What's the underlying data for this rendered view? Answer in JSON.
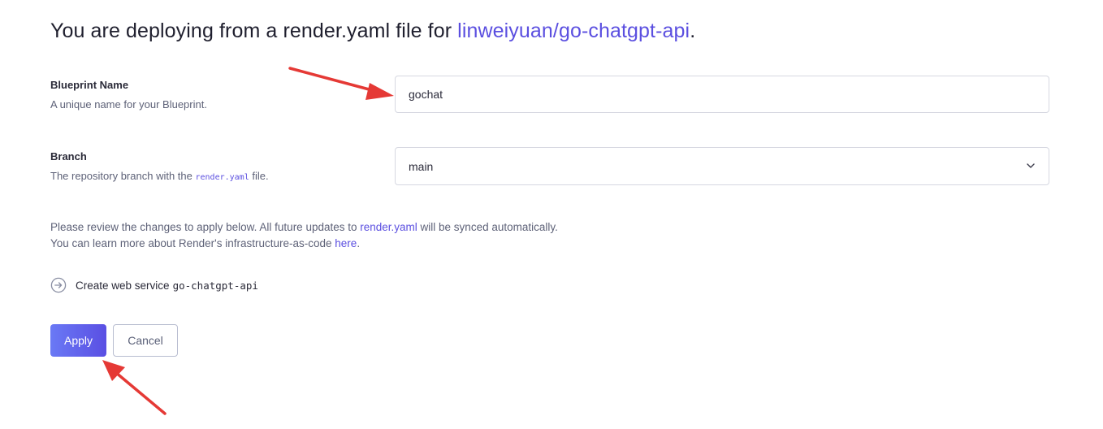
{
  "header": {
    "title_prefix": "You are deploying from a render.yaml file for ",
    "repo": "linweiyuan/go-chatgpt-api",
    "title_suffix": "."
  },
  "blueprint": {
    "label": "Blueprint Name",
    "help": "A unique name for your Blueprint.",
    "value": "gochat"
  },
  "branch": {
    "label": "Branch",
    "help_prefix": "The repository branch with the ",
    "help_code": "render.yaml",
    "help_suffix": " file.",
    "selected": "main"
  },
  "info": {
    "line1_prefix": "Please review the changes to apply below. All future updates to ",
    "line1_link": "render.yaml",
    "line1_suffix": " will be synced automatically.",
    "line2_prefix": "You can learn more about Render's infrastructure-as-code ",
    "line2_link": "here",
    "line2_suffix": "."
  },
  "changes": [
    {
      "icon": "arrow-circle-icon",
      "text": "Create web service",
      "service": "go-chatgpt-api"
    }
  ],
  "actions": {
    "apply_label": "Apply",
    "cancel_label": "Cancel"
  },
  "colors": {
    "accent": "#5b4fe0",
    "annotation_arrow": "#e53935"
  }
}
